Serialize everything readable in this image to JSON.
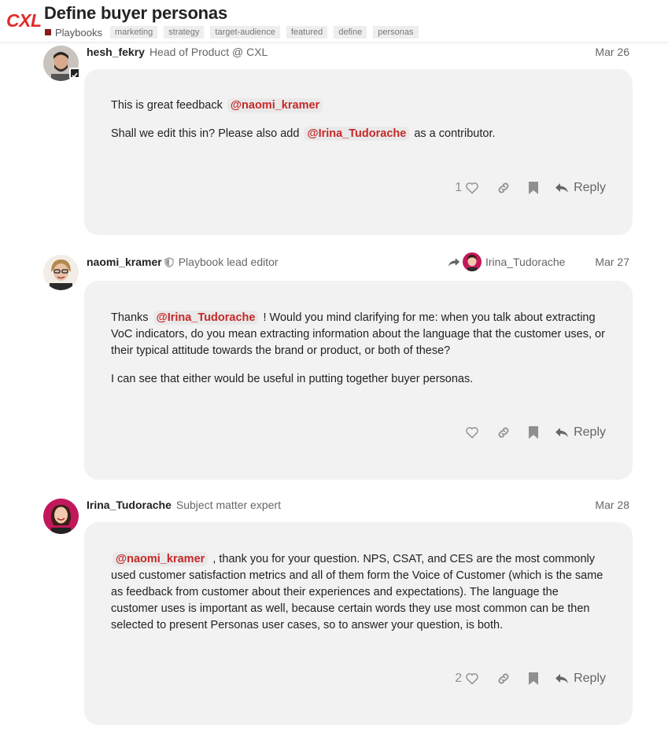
{
  "header": {
    "logo": "CXL",
    "title": "Define buyer personas",
    "category": "Playbooks",
    "category_color": "#8b1a1a",
    "tags": [
      "marketing",
      "strategy",
      "target-audience",
      "featured",
      "define",
      "personas"
    ]
  },
  "posts": [
    {
      "username": "hesh_fekry",
      "user_title": "Head of Product @ CXL",
      "date": "Mar 26",
      "avatar_icon": "man-with-beard-avatar",
      "body": {
        "p1_text": "This is great feedback",
        "p1_mention": "@naomi_kramer",
        "p2_pre": "Shall we edit this in? Please also add",
        "p2_mention": "@Irina_Tudorache",
        "p2_post": "as a contributor."
      },
      "likes": "1",
      "reply_label": "Reply"
    },
    {
      "username": "naomi_kramer",
      "user_title": "Playbook lead editor",
      "reply_to": "Irina_Tudorache",
      "date": "Mar 27",
      "avatar_icon": "woman-with-glasses-avatar",
      "body": {
        "p1_pre": "Thanks",
        "p1_mention": "@Irina_Tudorache",
        "p1_post": "! Would you mind clarifying for me: when you talk about extracting VoC indicators, do you mean extracting information about the language that the customer uses, or their typical attitude towards the brand or product, or both of these?",
        "p2": "I can see that either would be useful in putting together buyer personas."
      },
      "likes": "",
      "reply_label": "Reply"
    },
    {
      "username": "Irina_Tudorache",
      "user_title": "Subject matter expert",
      "date": "Mar 28",
      "avatar_icon": "woman-smiling-avatar",
      "body": {
        "p1_mention": "@naomi_kramer",
        "p1_post": ", thank you for your question. NPS, CSAT, and CES are the most commonly used customer satisfaction metrics and all of them form the Voice of Customer (which is the same as feedback from customer about their experiences and expectations). The language the customer uses is important as well, because certain words they use most common can be then selected to present Personas user cases, so to answer your question, is both."
      },
      "likes": "2",
      "reply_label": "Reply"
    }
  ]
}
